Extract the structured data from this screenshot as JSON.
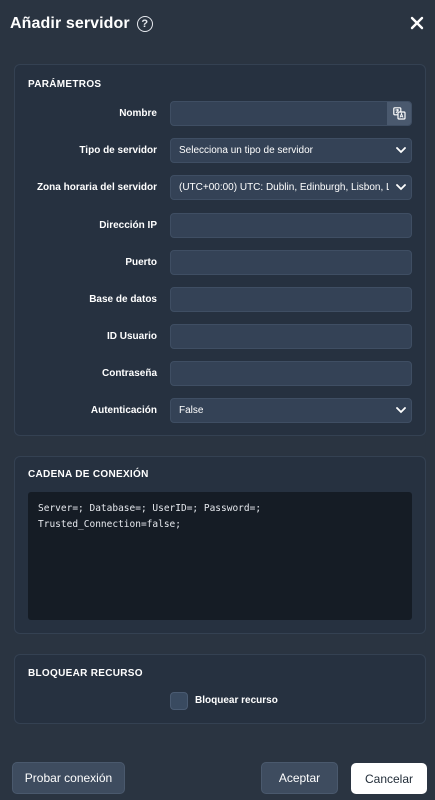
{
  "dialog": {
    "title": "Añadir servidor"
  },
  "parameters": {
    "section_title": "PARÁMETROS",
    "fields": {
      "name": {
        "label": "Nombre",
        "value": ""
      },
      "server_type": {
        "label": "Tipo de servidor",
        "value": "Selecciona un tipo de servidor"
      },
      "timezone": {
        "label": "Zona horaria del servidor",
        "value": "(UTC+00:00) UTC: Dublin, Edinburgh, Lisbon, L"
      },
      "ip": {
        "label": "Dirección IP",
        "value": ""
      },
      "port": {
        "label": "Puerto",
        "value": ""
      },
      "database": {
        "label": "Base de datos",
        "value": ""
      },
      "user_id": {
        "label": "ID Usuario",
        "value": ""
      },
      "password": {
        "label": "Contraseña",
        "value": ""
      },
      "auth": {
        "label": "Autenticación",
        "value": "False"
      }
    }
  },
  "connection_string": {
    "section_title": "CADENA DE CONEXIÓN",
    "value": "Server=; Database=; UserID=; Password=;\nTrusted_Connection=false;"
  },
  "lock_resource": {
    "section_title": "BLOQUEAR RECURSO",
    "checkbox_label": "Bloquear recurso",
    "checked": false
  },
  "footer": {
    "test_label": "Probar conexión",
    "accept_label": "Aceptar",
    "cancel_label": "Cancelar"
  },
  "icons": {
    "help": "help-circle-icon",
    "close": "close-icon",
    "translate": "translate-icon",
    "dropdown": "chevron-down-icon"
  },
  "colors": {
    "background": "#2a3441",
    "panel": "#263140",
    "field": "#344256",
    "code_background": "#151c25",
    "cancel_button": "#ffffff"
  }
}
